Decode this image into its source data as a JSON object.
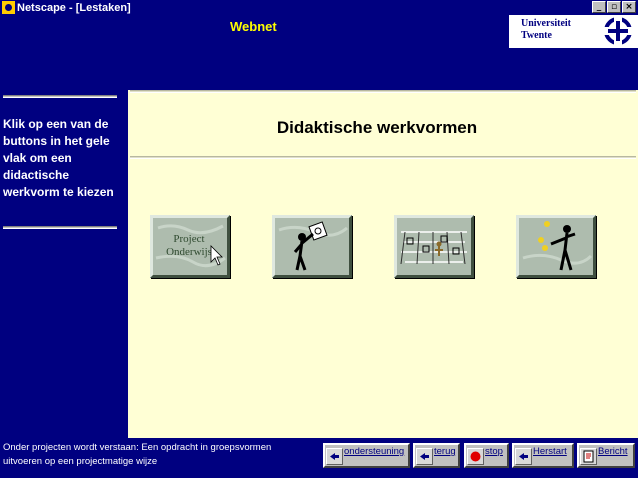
{
  "window": {
    "title": "Netscape - [Lestaken]",
    "controls": [
      "_",
      "▫",
      "×"
    ]
  },
  "header": {
    "site_name": "Webnet",
    "logo_line1": "Universiteit",
    "logo_line2": "Twente"
  },
  "sidebar": {
    "instruction": "Klik op een van de buttons in het gele vlak om een didactische werkvorm te kiezen"
  },
  "main": {
    "title": "Didaktische werkvormen",
    "tiles": [
      {
        "name": "project-onderwijs",
        "text_line1": "Project",
        "text_line2": "Onderwijs"
      },
      {
        "name": "presentation",
        "icon": "presenter-figure"
      },
      {
        "name": "group-work",
        "icon": "classroom-scene"
      },
      {
        "name": "individual",
        "icon": "juggler-figure"
      }
    ]
  },
  "status": {
    "description": "Onder projecten wordt verstaan: Een opdracht in groepsvormen uitvoeren op een projectmatige wijze"
  },
  "nav": {
    "support": "ondersteuning",
    "back": "terug",
    "stop": "stop",
    "restart": "Herstart",
    "message": "Bericht"
  },
  "colors": {
    "navy": "#000080",
    "panel": "#ffffd5",
    "site_name": "#ffff00"
  }
}
